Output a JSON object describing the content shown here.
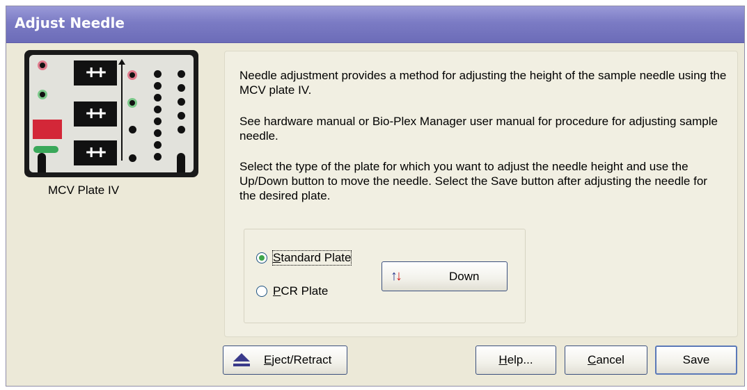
{
  "window": {
    "title": "Adjust Needle"
  },
  "plate_image": {
    "caption": "MCV Plate IV"
  },
  "instructions": {
    "p1": "Needle adjustment provides a method for adjusting the height of the sample needle using the MCV plate IV.",
    "p2": "See hardware manual or Bio-Plex Manager user manual for procedure for adjusting sample needle.",
    "p3": "Select the type of the plate for which you want to adjust the needle height and use the Up/Down button to move the needle. Select the Save button after adjusting the needle for the desired plate."
  },
  "plate_type": {
    "options": [
      {
        "label": "Standard Plate",
        "selected": true
      },
      {
        "label": "PCR Plate",
        "selected": false
      }
    ]
  },
  "buttons": {
    "updown": "Down",
    "eject": "Eject/Retract",
    "help": "Help...",
    "cancel": "Cancel",
    "save": "Save"
  },
  "colors": {
    "title_bar": "#7b7bc4",
    "dialog_bg": "#ece9d8",
    "up_arrow": "#2a3a8c",
    "down_arrow": "#d11b1b"
  }
}
